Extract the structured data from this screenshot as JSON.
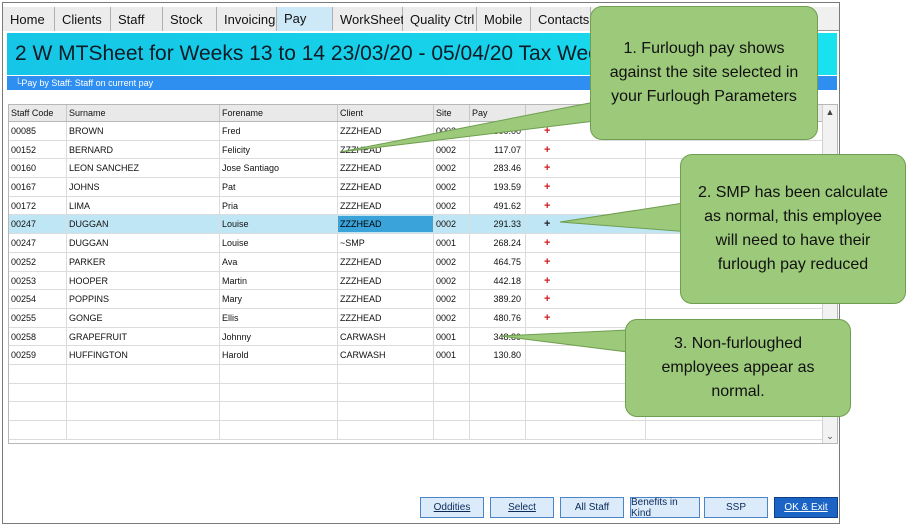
{
  "tabs": [
    {
      "label": "Home",
      "w": 52
    },
    {
      "label": "Clients",
      "w": 56
    },
    {
      "label": "Staff",
      "w": 52
    },
    {
      "label": "Stock",
      "w": 54
    },
    {
      "label": "Invoicing",
      "w": 60
    },
    {
      "label": "Pay",
      "w": 56,
      "active": true
    },
    {
      "label": "WorkSheet",
      "w": 70
    },
    {
      "label": "Quality Ctrl",
      "w": 74
    },
    {
      "label": "Mobile",
      "w": 54
    },
    {
      "label": "Contacts",
      "w": 60
    }
  ],
  "banner": {
    "title": "2 W MTSheet for Weeks 13 to 14 23/03/20 - 05/04/20 Tax Weeks 01 t"
  },
  "substrip": {
    "label": "└Pay by Staff: Staff on current pay"
  },
  "grid": {
    "headers": [
      "Staff Code",
      "Surname",
      "Forename",
      "Client",
      "Site",
      "Pay"
    ],
    "rows": [
      {
        "code": "00085",
        "surname": "BROWN",
        "forename": "Fred",
        "client": "ZZZHEAD",
        "site": "0002",
        "pay": "500.00",
        "mark": "+"
      },
      {
        "code": "00152",
        "surname": "BERNARD",
        "forename": "Felicity",
        "client": "ZZZHEAD",
        "site": "0002",
        "pay": "117.07",
        "mark": "+"
      },
      {
        "code": "00160",
        "surname": "LEON SANCHEZ",
        "forename": "Jose Santiago",
        "client": "ZZZHEAD",
        "site": "0002",
        "pay": "283.46",
        "mark": "+"
      },
      {
        "code": "00167",
        "surname": "JOHNS",
        "forename": "Pat",
        "client": "ZZZHEAD",
        "site": "0002",
        "pay": "193.59",
        "mark": "+"
      },
      {
        "code": "00172",
        "surname": "LIMA",
        "forename": "Pria",
        "client": "ZZZHEAD",
        "site": "0002",
        "pay": "491.62",
        "mark": "+"
      },
      {
        "code": "00247",
        "surname": "DUGGAN",
        "forename": "Louise",
        "client": "ZZZHEAD",
        "site": "0002",
        "pay": "291.33",
        "mark": "+",
        "selected": true
      },
      {
        "code": "00247",
        "surname": "DUGGAN",
        "forename": "Louise",
        "client": "~SMP",
        "site": "0001",
        "pay": "268.24",
        "mark": "+"
      },
      {
        "code": "00252",
        "surname": "PARKER",
        "forename": "Ava",
        "client": "ZZZHEAD",
        "site": "0002",
        "pay": "464.75",
        "mark": "+"
      },
      {
        "code": "00253",
        "surname": "HOOPER",
        "forename": "Martin",
        "client": "ZZZHEAD",
        "site": "0002",
        "pay": "442.18",
        "mark": "+"
      },
      {
        "code": "00254",
        "surname": "POPPINS",
        "forename": "Mary",
        "client": "ZZZHEAD",
        "site": "0002",
        "pay": "389.20",
        "mark": "+"
      },
      {
        "code": "00255",
        "surname": "GONGE",
        "forename": "Ellis",
        "client": "ZZZHEAD",
        "site": "0002",
        "pay": "480.76",
        "mark": "+"
      },
      {
        "code": "00258",
        "surname": "GRAPEFRUIT",
        "forename": "Johnny",
        "client": "CARWASH",
        "site": "0001",
        "pay": "348.80",
        "mark": ""
      },
      {
        "code": "00259",
        "surname": "HUFFINGTON",
        "forename": "Harold",
        "client": "CARWASH",
        "site": "0001",
        "pay": "130.80",
        "mark": ""
      }
    ],
    "empty_rows": 4
  },
  "buttons": [
    {
      "label": "Oddities",
      "underline": true
    },
    {
      "label": "Select",
      "underline": true
    },
    {
      "label": "All Staff"
    },
    {
      "label": "Benefits in Kind"
    },
    {
      "label": "SSP"
    },
    {
      "label": "OK & Exit",
      "primary": true,
      "underline": true
    }
  ],
  "callouts": [
    {
      "text": "1. Furlough pay shows against the site selected in your Furlough Parameters"
    },
    {
      "text": "2. SMP has been calculate as normal, this employee will need to have their furlough pay reduced"
    },
    {
      "text": "3. Non-furloughed employees appear as normal."
    }
  ],
  "colors": {
    "banner": "#17d3ea",
    "substrip": "#2f8ff0",
    "selected_row": "#bfe6f5",
    "callout": "#9cc97a",
    "plus": "#d11a1a"
  }
}
